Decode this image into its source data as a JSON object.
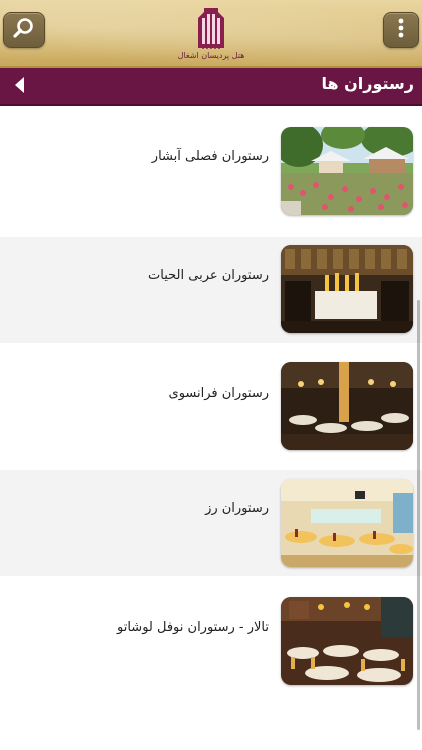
{
  "header": {
    "logo_caption": "هتل پردیسان اشغال",
    "search_icon": "search-icon",
    "menu_icon": "vertical-dots-icon"
  },
  "titlebar": {
    "title": "رستوران ها",
    "back_icon": "back-arrow-icon"
  },
  "restaurants": [
    {
      "name": "رستوران فصلی آبشار",
      "image": "outdoor-garden-restaurant-photo"
    },
    {
      "name": "رستوران عربی الحیات",
      "image": "arabic-restaurant-interior-photo"
    },
    {
      "name": "رستوران فرانسوی",
      "image": "french-restaurant-interior-photo"
    },
    {
      "name": "رستوران رز",
      "image": "banquet-hall-photo"
    },
    {
      "name": "تالار - رستوران نوفل لوشاتو",
      "image": "hall-restaurant-photo"
    }
  ],
  "colors": {
    "header_gold": "#dcc27d",
    "title_bar": "#6a1645",
    "alt_row": "#f3f3f3"
  }
}
